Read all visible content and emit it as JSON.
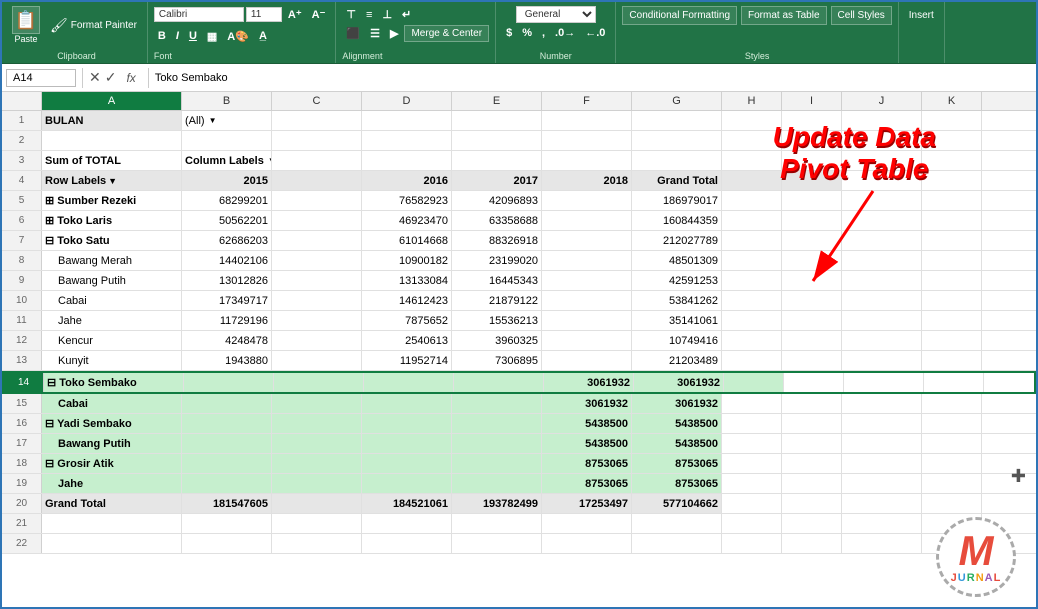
{
  "ribbon": {
    "paste_label": "Paste",
    "format_painter": "Format Painter",
    "font_name": "Calibri",
    "font_size": "11",
    "bold": "B",
    "italic": "I",
    "underline": "U",
    "merge_center": "Merge & Center",
    "conditional_formatting": "Conditional Formatting",
    "format_as_table": "Format as Table",
    "cell_styles": "Cell Styles",
    "insert_label": "Insert",
    "clipboard_label": "Clipboard",
    "font_label": "Font",
    "alignment_label": "Alignment",
    "number_label": "Number",
    "styles_label": "Styles"
  },
  "formula_bar": {
    "cell_ref": "A14",
    "formula": "Toko Sembako"
  },
  "columns": [
    "A",
    "B",
    "C",
    "D",
    "E",
    "F",
    "G",
    "H",
    "I",
    "J",
    "K"
  ],
  "rows": [
    {
      "num": 1,
      "cells": [
        "BULAN",
        "(All)",
        "",
        "",
        "",
        "",
        "",
        "",
        "",
        "",
        ""
      ]
    },
    {
      "num": 2,
      "cells": [
        "",
        "",
        "",
        "",
        "",
        "",
        "",
        "",
        "",
        "",
        ""
      ]
    },
    {
      "num": 3,
      "cells": [
        "Sum of TOTAL",
        "Column Labels ▼",
        "",
        "",
        "",
        "",
        "",
        "",
        "",
        "",
        ""
      ]
    },
    {
      "num": 4,
      "cells": [
        "Row Labels ▼",
        "2015",
        "",
        "2016",
        "2017",
        "2018",
        "Grand Total",
        "",
        "",
        "",
        ""
      ]
    },
    {
      "num": 5,
      "cells": [
        "+ Sumber Rezeki",
        "68299201",
        "",
        "76582923",
        "42096893",
        "",
        "186979017",
        "",
        "",
        "",
        ""
      ]
    },
    {
      "num": 6,
      "cells": [
        "+ Toko Laris",
        "50562201",
        "",
        "46923470",
        "63358688",
        "",
        "160844359",
        "",
        "",
        "",
        ""
      ]
    },
    {
      "num": 7,
      "cells": [
        "- Toko Satu",
        "62686203",
        "",
        "61014668",
        "88326918",
        "",
        "212027789",
        "",
        "",
        "",
        ""
      ]
    },
    {
      "num": 8,
      "cells": [
        "  Bawang Merah",
        "14402106",
        "",
        "10900182",
        "23199020",
        "",
        "48501309",
        "",
        "",
        "",
        ""
      ]
    },
    {
      "num": 9,
      "cells": [
        "  Bawang Putih",
        "13012826",
        "",
        "13133084",
        "16445343",
        "",
        "42591253",
        "",
        "",
        "",
        ""
      ]
    },
    {
      "num": 10,
      "cells": [
        "  Cabai",
        "17349717",
        "",
        "14612423",
        "21879122",
        "",
        "53841262",
        "",
        "",
        "",
        ""
      ]
    },
    {
      "num": 11,
      "cells": [
        "  Jahe",
        "11729196",
        "",
        "7875652",
        "15536213",
        "",
        "35141061",
        "",
        "",
        "",
        ""
      ]
    },
    {
      "num": 12,
      "cells": [
        "  Kencur",
        "4248478",
        "",
        "2540613",
        "3960325",
        "",
        "10749416",
        "",
        "",
        "",
        ""
      ]
    },
    {
      "num": 13,
      "cells": [
        "  Kunyit",
        "1943880",
        "",
        "11952714",
        "7306895",
        "",
        "21203489",
        "",
        "",
        "",
        ""
      ]
    },
    {
      "num": 14,
      "cells": [
        "- Toko Sembako",
        "",
        "",
        "",
        "",
        "3061932",
        "3061932",
        "",
        "",
        "",
        ""
      ]
    },
    {
      "num": 15,
      "cells": [
        "  Cabai",
        "",
        "",
        "",
        "",
        "3061932",
        "3061932",
        "",
        "",
        "",
        ""
      ]
    },
    {
      "num": 16,
      "cells": [
        "- Yadi Sembako",
        "",
        "",
        "",
        "",
        "5438500",
        "5438500",
        "",
        "",
        "",
        ""
      ]
    },
    {
      "num": 17,
      "cells": [
        "  Bawang Putih",
        "",
        "",
        "",
        "",
        "5438500",
        "5438500",
        "",
        "",
        "",
        ""
      ]
    },
    {
      "num": 18,
      "cells": [
        "- Grosir Atik",
        "",
        "",
        "",
        "",
        "8753065",
        "8753065",
        "",
        "",
        "",
        ""
      ]
    },
    {
      "num": 19,
      "cells": [
        "  Jahe",
        "",
        "",
        "",
        "",
        "8753065",
        "8753065",
        "",
        "",
        "",
        ""
      ]
    },
    {
      "num": 20,
      "cells": [
        "Grand Total",
        "181547605",
        "",
        "184521061",
        "193782499",
        "17253497",
        "577104662",
        "",
        "",
        "",
        ""
      ]
    },
    {
      "num": 21,
      "cells": [
        "",
        "",
        "",
        "",
        "",
        "",
        "",
        "",
        "",
        "",
        ""
      ]
    },
    {
      "num": 22,
      "cells": [
        "",
        "",
        "",
        "",
        "",
        "",
        "",
        "",
        "",
        "",
        ""
      ]
    }
  ],
  "annotation": {
    "line1": "Update Data",
    "line2": "Pivot Table"
  }
}
